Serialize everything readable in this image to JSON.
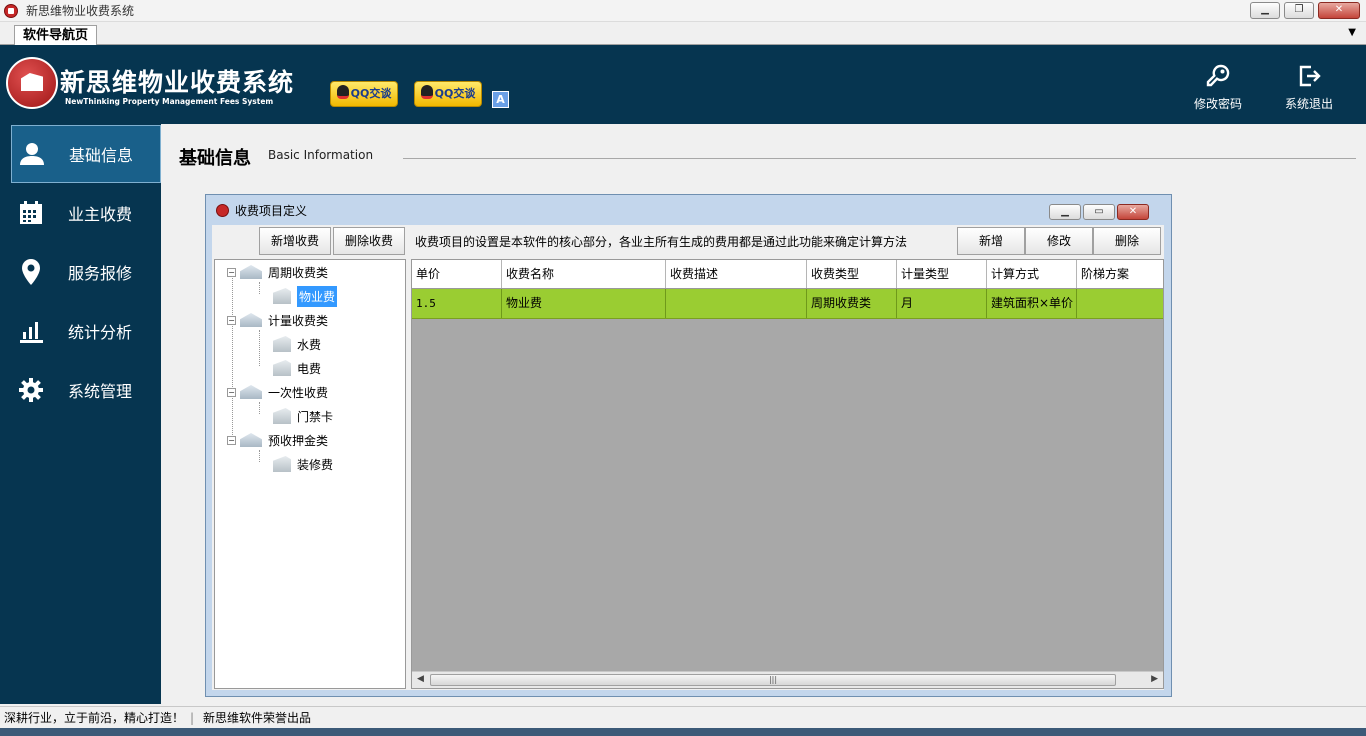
{
  "window": {
    "title": "新思维物业收费系统"
  },
  "tabs": [
    {
      "label": "软件导航页"
    }
  ],
  "header": {
    "brand_title": "新思维物业收费系统",
    "brand_subtitle": "NewThinking  Property Management Fees System",
    "qq_buttons": [
      {
        "label": "QQ交谈"
      },
      {
        "label": "QQ交谈"
      }
    ],
    "badge": "A",
    "actions": [
      {
        "label": "修改密码",
        "icon": "key-icon"
      },
      {
        "label": "系统退出",
        "icon": "logout-icon"
      }
    ]
  },
  "sidebar": {
    "items": [
      {
        "label": "基础信息",
        "icon": "user-icon",
        "active": true
      },
      {
        "label": "业主收费",
        "icon": "calendar-icon"
      },
      {
        "label": "服务报修",
        "icon": "location-pin-icon"
      },
      {
        "label": "统计分析",
        "icon": "bar-chart-icon"
      },
      {
        "label": "系统管理",
        "icon": "gear-icon"
      }
    ]
  },
  "page": {
    "title": "基础信息",
    "subtitle": "Basic Information"
  },
  "dialog": {
    "title": "收费项目定义",
    "left_buttons": {
      "add": "新增收费",
      "delete": "删除收费"
    },
    "tip": "收费项目的设置是本软件的核心部分，各业主所有生成的费用都是通过此功能来确定计算方法",
    "right_buttons": {
      "add": "新增",
      "edit": "修改",
      "delete": "删除"
    },
    "tree": [
      {
        "label": "周期收费类",
        "children": [
          "物业费"
        ]
      },
      {
        "label": "计量收费类",
        "children": [
          "水费",
          "电费"
        ]
      },
      {
        "label": "一次性收费",
        "children": [
          "门禁卡"
        ]
      },
      {
        "label": "预收押金类",
        "children": [
          "装修费"
        ]
      }
    ],
    "selected_node": "物业费",
    "grid": {
      "columns": [
        "单价",
        "收费名称",
        "收费描述",
        "收费类型",
        "计量类型",
        "计算方式",
        "阶梯方案"
      ],
      "rows": [
        [
          "1.5",
          "物业费",
          "",
          "周期收费类",
          "月",
          "建筑面积×单价",
          ""
        ]
      ]
    }
  },
  "statusbar": {
    "left": "深耕行业，立于前沿，精心打造！",
    "separator": "|",
    "right": "新思维软件荣誉出品"
  }
}
